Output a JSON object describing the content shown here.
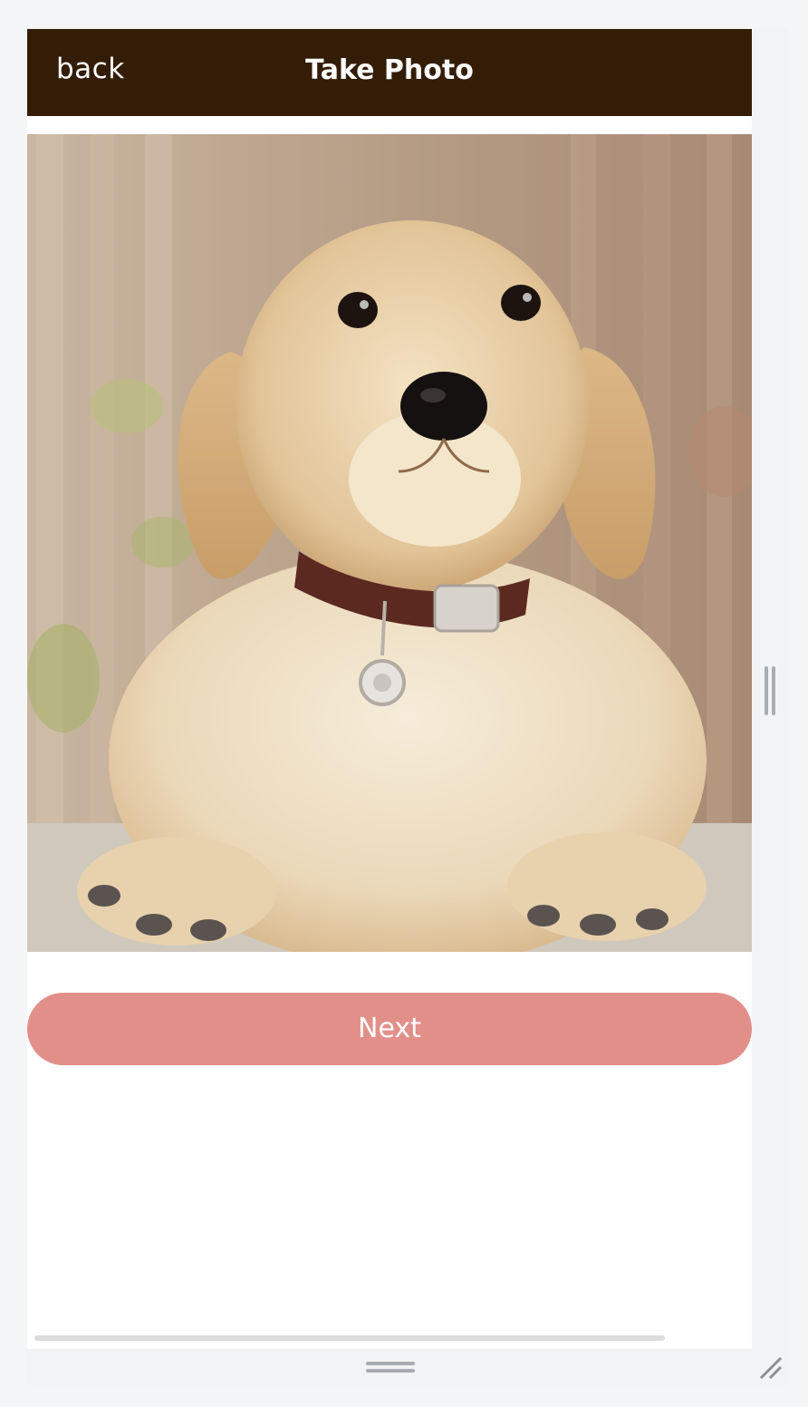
{
  "header": {
    "back_label": "back",
    "title": "Take Photo"
  },
  "photo": {
    "subject_icon": "puppy-photo"
  },
  "actions": {
    "next_label": "Next"
  },
  "colors": {
    "header_bg": "#331d06",
    "accent": "#e28f8a",
    "text_on_dark": "#ffffff"
  }
}
